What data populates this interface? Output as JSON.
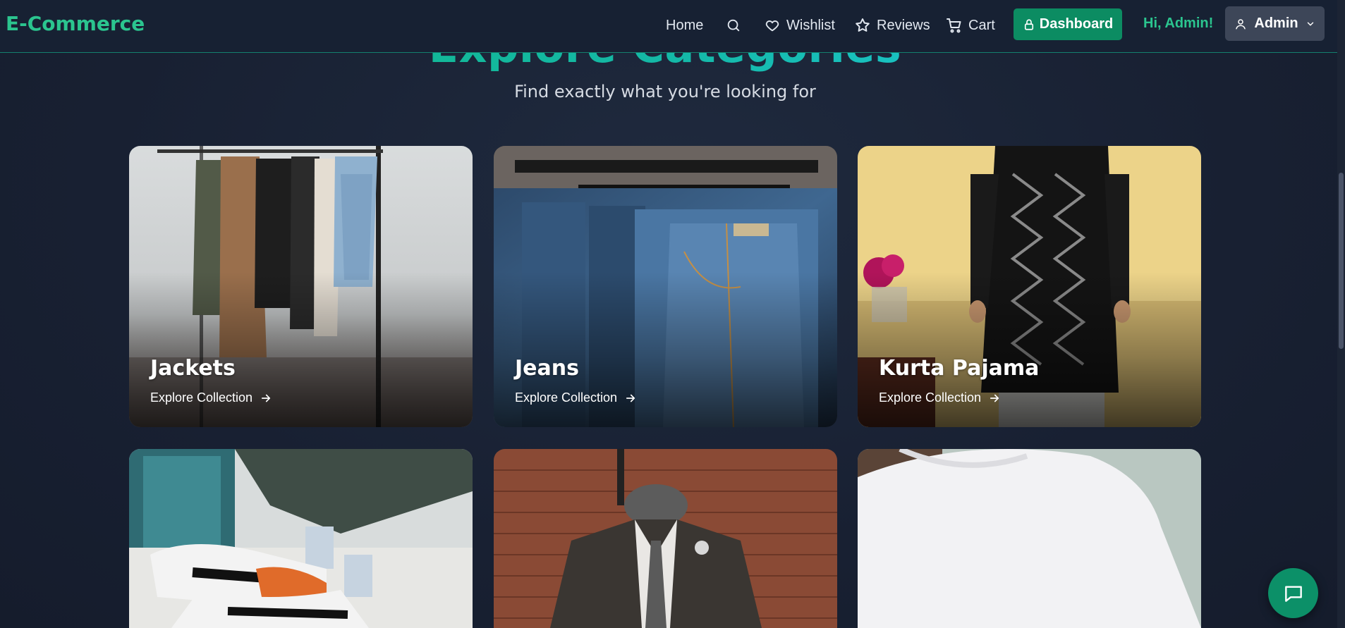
{
  "brand": "E-Commerce",
  "nav": {
    "home": "Home",
    "wishlist": "Wishlist",
    "reviews": "Reviews",
    "cart": "Cart",
    "dashboard": "Dashboard",
    "greeting": "Hi, Admin!",
    "user": "Admin"
  },
  "section": {
    "title": "Explore Categories",
    "subtitle": "Find exactly what you're looking for"
  },
  "categories": [
    {
      "name": "Jackets",
      "cta": "Explore Collection"
    },
    {
      "name": "Jeans",
      "cta": "Explore Collection"
    },
    {
      "name": "Kurta Pajama",
      "cta": "Explore Collection"
    }
  ],
  "colors": {
    "accent": "#2bc58f",
    "dashboard_button": "#0c8c62",
    "background": "#1a2233"
  }
}
